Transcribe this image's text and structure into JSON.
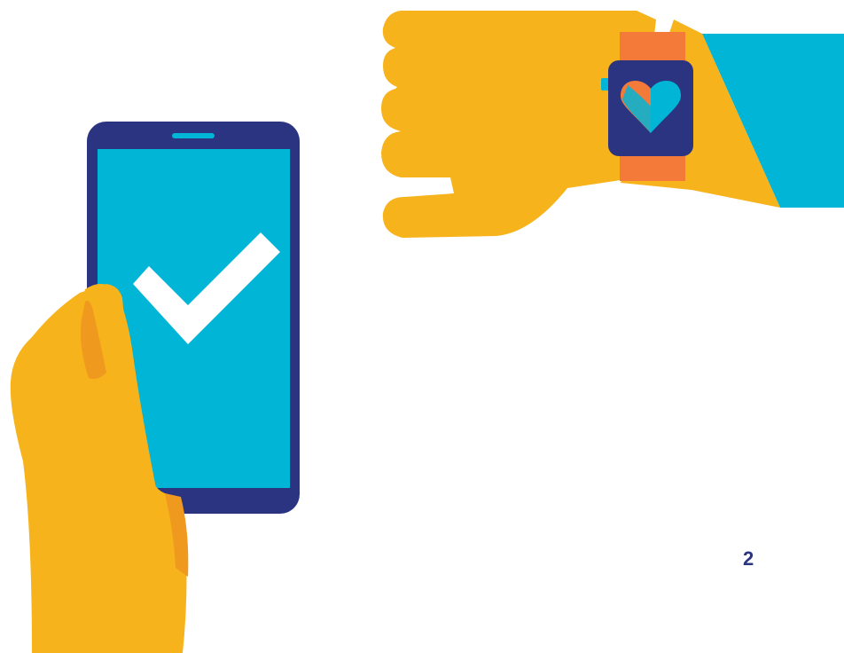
{
  "page": {
    "number": "2"
  },
  "illustration": {
    "phone_icon": "smartphone-checkmark",
    "watch_icon": "smartwatch-heart",
    "colors": {
      "skin": "#f6b31b",
      "skin_shadow": "#ef9a1f",
      "phone_body": "#2b3481",
      "screen": "#00b5d6",
      "watch_band": "#f37a38",
      "sleeve": "#00b5d6",
      "check": "#ffffff",
      "page_number": "#2b3481"
    }
  }
}
